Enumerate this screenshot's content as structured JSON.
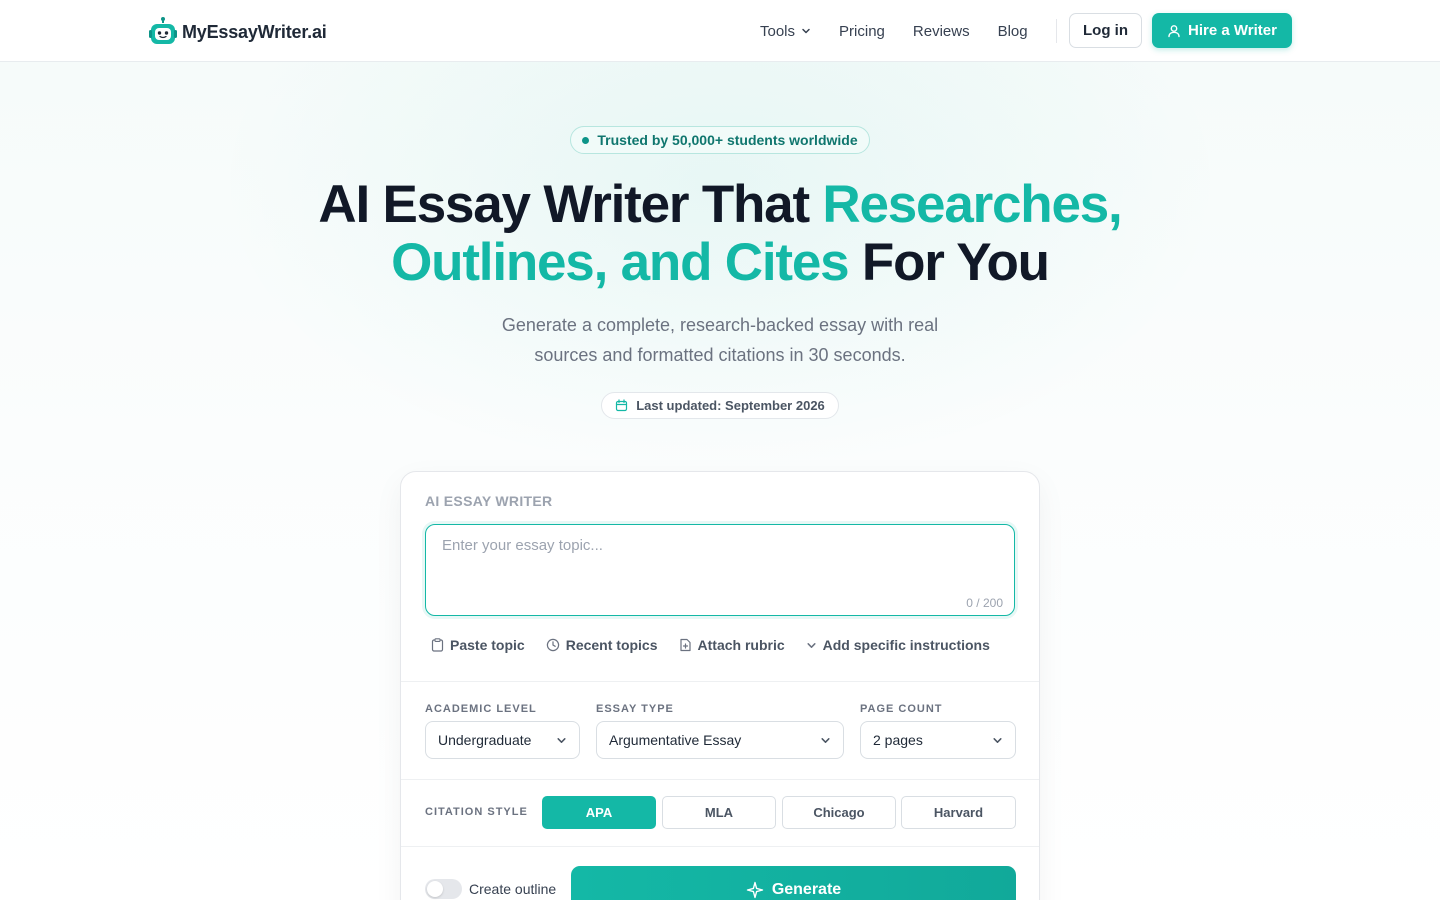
{
  "brand": {
    "name": "MyEssayWriter.ai",
    "accent": "#14b8a6"
  },
  "nav": {
    "tools": "Tools",
    "pricing": "Pricing",
    "reviews": "Reviews",
    "blog": "Blog",
    "login": "Log in",
    "hire": "Hire a Writer"
  },
  "hero": {
    "trust": "Trusted by 50,000+ students worldwide",
    "headline_part1": "AI Essay Writer That ",
    "headline_accent1": "Researches,",
    "headline_accent2": "Outlines, and Cites",
    "headline_part2": " For You",
    "subhead": "Generate a complete, research-backed essay with real sources and formatted citations in 30 seconds.",
    "updated": "Last updated: September 2026"
  },
  "card": {
    "label": "AI ESSAY WRITER",
    "topic_placeholder": "Enter your essay topic...",
    "topic_value": "",
    "counter": "0 / 200",
    "tools": [
      "Paste topic",
      "Recent topics",
      "Attach rubric",
      "Add specific instructions"
    ],
    "academic_level": {
      "label": "ACADEMIC LEVEL",
      "value": "Undergraduate"
    },
    "essay_type": {
      "label": "ESSAY TYPE",
      "value": "Argumentative Essay"
    },
    "page_count": {
      "label": "PAGE COUNT",
      "value": "2 pages"
    },
    "citation": {
      "label": "CITATION STYLE",
      "options": [
        "APA",
        "MLA",
        "Chicago",
        "Harvard"
      ],
      "selected": "APA"
    },
    "outline_toggle": {
      "label": "Create outline",
      "on": false
    },
    "generate": "Generate"
  }
}
